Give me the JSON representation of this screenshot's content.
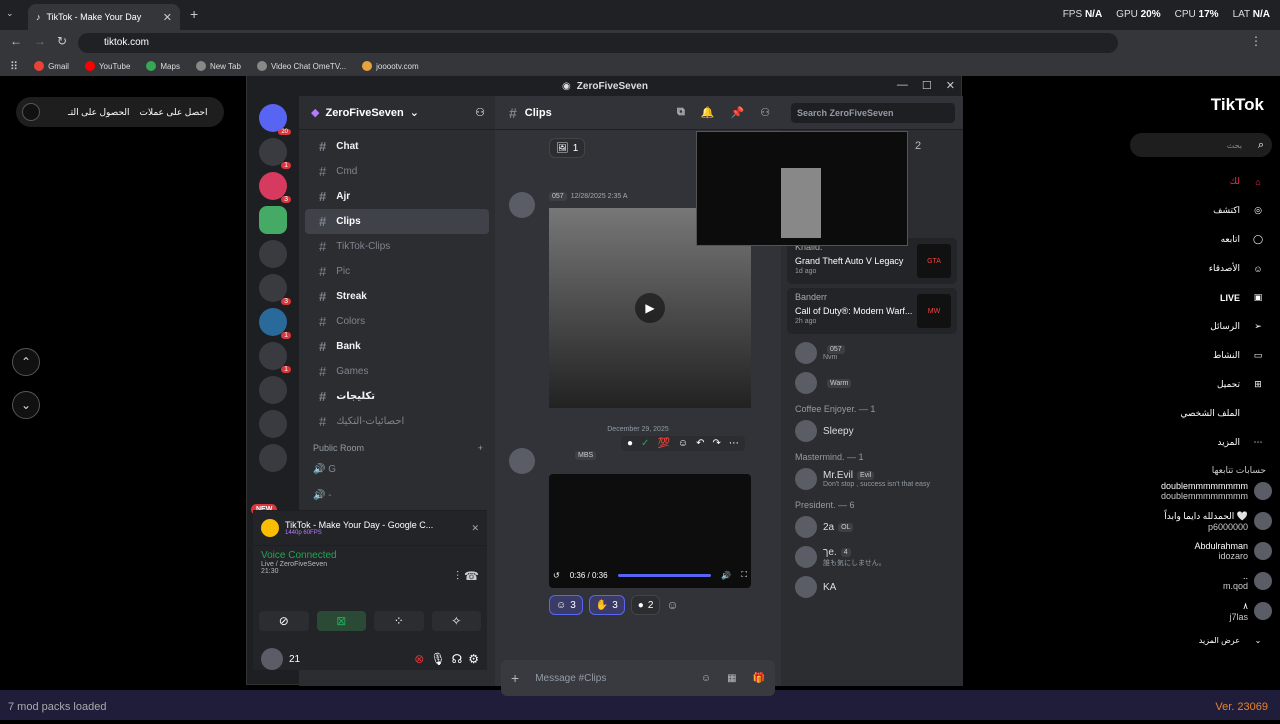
{
  "browser": {
    "tab_title": "TikTok - Make Your Day",
    "url": "tiktok.com",
    "bookmarks": [
      "Gmail",
      "YouTube",
      "Maps",
      "New Tab",
      "Video Chat OmeTV...",
      "jooootv.com"
    ],
    "stats": {
      "fps_label": "FPS",
      "fps": "N/A",
      "gpu_label": "GPU",
      "gpu": "20%",
      "cpu_label": "CPU",
      "cpu": "17%",
      "lat_label": "LAT",
      "lat": "N/A"
    }
  },
  "tiktok": {
    "logo": "TikTok",
    "search_placeholder": "بحث",
    "left_pill": {
      "get_coins": "احصل على عملات",
      "get_app": "الحصول على التـ"
    },
    "nav": [
      "اكتشف",
      "اتابعه",
      "الأصدقاء",
      "LIVE",
      "الرسائل",
      "النشاط",
      "تحميل",
      "الملف الشخصي",
      "المزيد"
    ],
    "nav_foryou": "لك",
    "following_title": "حسابات تتابعها",
    "following": [
      {
        "name": "doublemmmmmmmm",
        "handle": "doublemmmmmmmm"
      },
      {
        "name": "الحمدلله دايما وابداً 🤍",
        "handle": "p6000000"
      },
      {
        "name": "Abdulrahman",
        "handle": "idozaro"
      },
      {
        "name": "..",
        "handle": "m.qod"
      },
      {
        "name": "٨",
        "handle": "j7las"
      }
    ],
    "see_more": "عرض المزيد",
    "statusbar": "7 mod packs loaded",
    "version": "Ver. 23069"
  },
  "discord": {
    "window_title": "ZeroFiveSeven",
    "server_name": "ZeroFiveSeven",
    "new_badge": "NEW",
    "channels": [
      {
        "name": "Chat",
        "bold": true
      },
      {
        "name": "Cmd",
        "bold": false
      },
      {
        "name": "Ajr",
        "bold": true
      },
      {
        "name": "Clips",
        "bold": true,
        "selected": true
      },
      {
        "name": "TikTok-Clips",
        "bold": false
      },
      {
        "name": "Pic",
        "bold": false
      },
      {
        "name": "Streak",
        "bold": true
      },
      {
        "name": "Colors",
        "bold": false
      },
      {
        "name": "Bank",
        "bold": true
      },
      {
        "name": "Games",
        "bold": false
      },
      {
        "name": "تكليجات",
        "bold": true
      },
      {
        "name": "احصائيات-التكيك",
        "bold": false
      }
    ],
    "voice_category": "Public Room",
    "voice_channels": [
      "G",
      "-"
    ],
    "stream_card": {
      "title": "TikTok - Make Your Day - Google C...",
      "quality": "1440p 60FPS"
    },
    "voice_status": "Voice Connected",
    "voice_channel": "Live / ZeroFiveSeven",
    "voice_time": "21:30",
    "user_name": "21",
    "channel_header": "Clips",
    "search_placeholder": "Search ZeroFiveSeven",
    "messages": {
      "reaction_top": "1",
      "msg1_tag": "057",
      "msg1_time": "12/28/2025 2:35 A",
      "date_divider": "December 29, 2025",
      "msg2_tag": "MBS",
      "video_time": "0:36 / 0:36",
      "reactions": [
        "3",
        "3",
        "2"
      ]
    },
    "composer_placeholder": "Message #Clips",
    "pip_count": "2",
    "game_cards": [
      {
        "user": "Khalid.",
        "game": "Grand Theft Auto V Legacy",
        "ago": "1d ago",
        "img": "GTA"
      },
      {
        "user": "Banderr",
        "game": "Call of Duty®: Modern Warf...",
        "ago": "2h ago",
        "img": "MW"
      }
    ],
    "members": [
      {
        "group": "",
        "name": "",
        "status": "Nvm",
        "tag": "057"
      },
      {
        "group": "",
        "name": "",
        "status": "",
        "tag": "Warm"
      },
      {
        "group": "Coffee Enjoyer. — 1",
        "name": "Sleepy",
        "status": "",
        "tag": ""
      },
      {
        "group": "Mastermind. — 1",
        "name": "Mr.Evil",
        "status": "Don't stop , success isn't that easy",
        "tag": "Evil"
      },
      {
        "group": "President. — 6",
        "name": "2a",
        "status": "",
        "tag": "OL"
      },
      {
        "group": "",
        "name": "ךe.",
        "status": "誰も気にしません。",
        "tag": "4"
      },
      {
        "group": "",
        "name": "KA",
        "status": "",
        "tag": ""
      }
    ]
  }
}
